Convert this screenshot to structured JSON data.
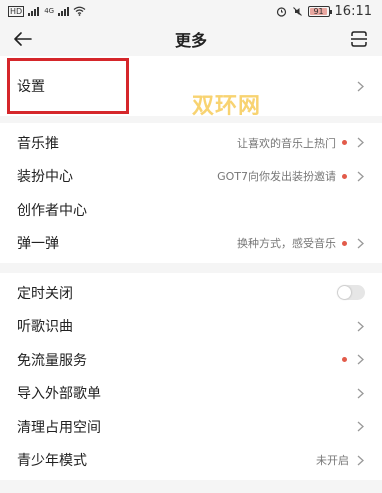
{
  "status_bar": {
    "carrier_left": "HD",
    "network": "4G",
    "time": "16:11",
    "battery": "91",
    "icons": [
      "signal-icon",
      "wifi-icon",
      "alarm-icon",
      "mute-icon",
      "battery-icon"
    ]
  },
  "header": {
    "title": "更多",
    "back_icon": "back-arrow-icon",
    "scan_icon": "scan-icon"
  },
  "watermark": "双环网",
  "section1": [
    {
      "label": "设置",
      "sub": "",
      "dot": false,
      "chevron": true
    }
  ],
  "section2": [
    {
      "label": "音乐推",
      "sub": "让喜欢的音乐上热门",
      "dot": true,
      "chevron": true
    },
    {
      "label": "装扮中心",
      "sub": "GOT7向你发出装扮邀请",
      "dot": true,
      "chevron": true
    },
    {
      "label": "创作者中心",
      "sub": "",
      "dot": false,
      "chevron": false
    },
    {
      "label": "弹一弹",
      "sub": "换种方式，感受音乐",
      "dot": true,
      "chevron": true
    }
  ],
  "section3": [
    {
      "label": "定时关闭",
      "toggle": "off"
    },
    {
      "label": "听歌识曲",
      "sub": "",
      "dot": false,
      "chevron": true
    },
    {
      "label": "免流量服务",
      "sub": "",
      "dot": true,
      "chevron": true
    },
    {
      "label": "导入外部歌单",
      "sub": "",
      "dot": false,
      "chevron": true
    },
    {
      "label": "清理占用空间",
      "sub": "",
      "dot": false,
      "chevron": true
    },
    {
      "label": "青少年模式",
      "sub": "未开启",
      "dot": false,
      "chevron": true
    }
  ],
  "colors": {
    "accent_dot": "#e25b4a",
    "highlight_box": "#d5262a",
    "watermark": "#f6c442"
  }
}
